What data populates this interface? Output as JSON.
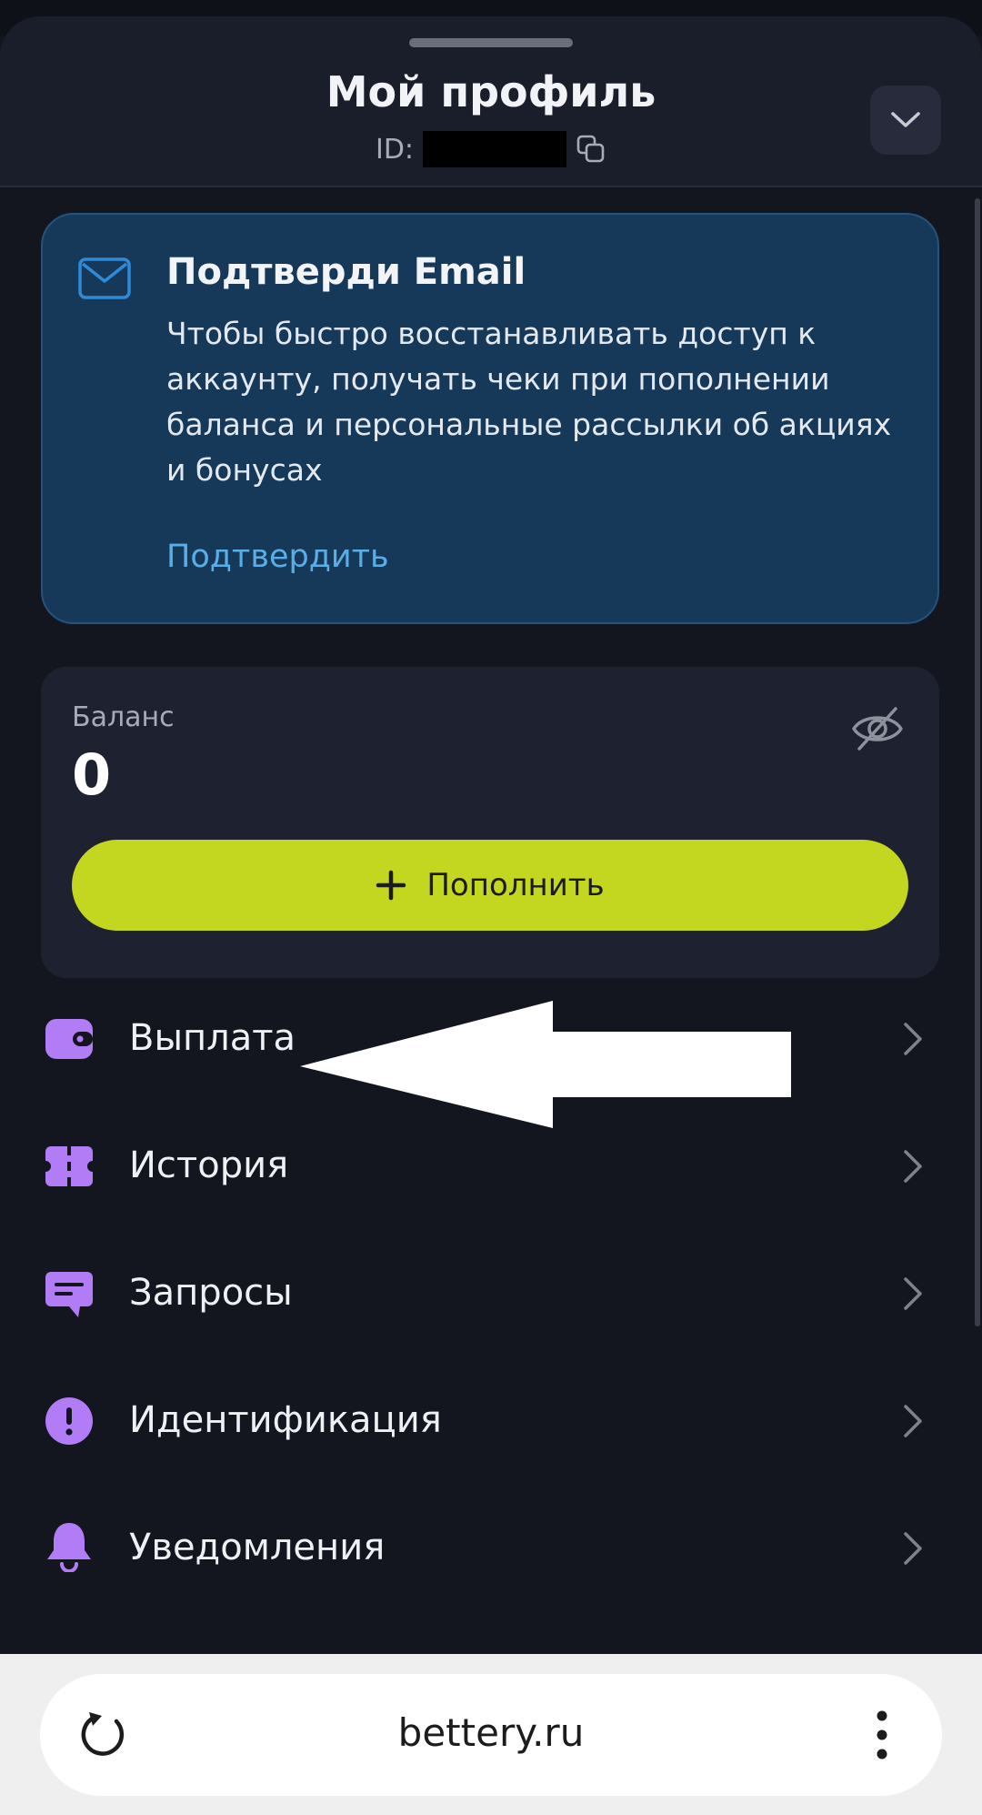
{
  "header": {
    "title": "Мой профиль",
    "id_label": "ID:"
  },
  "email_card": {
    "title": "Подтверди Email",
    "text": "Чтобы быстро восстанавливать доступ к аккаунту, получать чеки при пополнении баланса и персональные рассылки об акциях и бонусах",
    "link": "Подтвердить"
  },
  "balance": {
    "label": "Баланс",
    "value": "0",
    "topup_label": "Пополнить"
  },
  "menu": [
    {
      "label": "Выплата",
      "icon": "wallet-icon"
    },
    {
      "label": "История",
      "icon": "ticket-icon"
    },
    {
      "label": "Запросы",
      "icon": "chat-icon"
    },
    {
      "label": "Идентификация",
      "icon": "alert-icon"
    },
    {
      "label": "Уведомления",
      "icon": "bell-icon"
    }
  ],
  "browser": {
    "url": "bettery.ru"
  },
  "colors": {
    "background": "#14161f",
    "accent_lime": "#c3d620",
    "icon_purple": "#b27cf6",
    "email_card": "#173959",
    "link_blue": "#5aaee8"
  }
}
